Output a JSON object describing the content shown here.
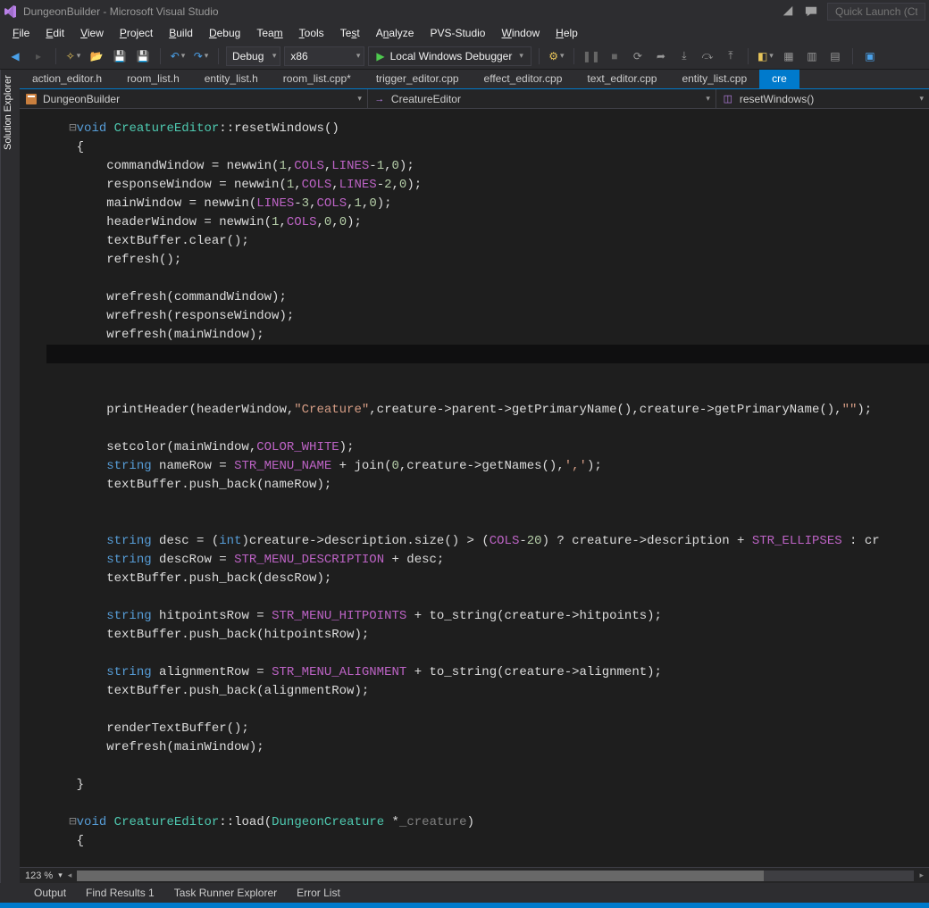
{
  "title": "DungeonBuilder - Microsoft Visual Studio",
  "quick_launch_placeholder": "Quick Launch (Ctrl+",
  "menu": [
    "File",
    "Edit",
    "View",
    "Project",
    "Build",
    "Debug",
    "Team",
    "Tools",
    "Test",
    "Analyze",
    "PVS-Studio",
    "Window",
    "Help"
  ],
  "toolbar": {
    "config": "Debug",
    "platform": "x86",
    "debugger": "Local Windows Debugger"
  },
  "side_panel": "Solution Explorer",
  "doc_tabs": [
    {
      "label": "action_editor.h",
      "active": false
    },
    {
      "label": "room_list.h",
      "active": false
    },
    {
      "label": "entity_list.h",
      "active": false
    },
    {
      "label": "room_list.cpp*",
      "active": false
    },
    {
      "label": "trigger_editor.cpp",
      "active": false
    },
    {
      "label": "effect_editor.cpp",
      "active": false
    },
    {
      "label": "text_editor.cpp",
      "active": false
    },
    {
      "label": "entity_list.cpp",
      "active": false
    },
    {
      "label": "cre",
      "active": true
    }
  ],
  "nav": {
    "scope": "DungeonBuilder",
    "class": "CreatureEditor",
    "member": "resetWindows()"
  },
  "zoom": "123 %",
  "bottom_tabs": [
    "Output",
    "Find Results 1",
    "Task Runner Explorer",
    "Error List"
  ],
  "code_tokens": {
    "void": "void",
    "cls": "CreatureEditor",
    "reset": "resetWindows",
    "load": "load",
    "DungeonCreature": "DungeonCreature",
    "creature_arg": "_creature",
    "str_creature": "\"Creature\"",
    "str_empty": "\"\"",
    "comma_ch": "','",
    "int": "int",
    "string": "string",
    "m_COLOR_WHITE": "COLOR_WHITE",
    "m_STR_MENU_NAME": "STR_MENU_NAME",
    "m_STR_MENU_DESCRIPTION": "STR_MENU_DESCRIPTION",
    "m_STR_MENU_HITPOINTS": "STR_MENU_HITPOINTS",
    "m_STR_MENU_ALIGNMENT": "STR_MENU_ALIGNMENT",
    "m_STR_ELLIPSES": "STR_ELLIPSES",
    "m_COLS": "COLS",
    "m_LINES": "LINES",
    "n0": "0",
    "n1": "1",
    "n2": "2",
    "n3": "3",
    "n20": "20"
  }
}
